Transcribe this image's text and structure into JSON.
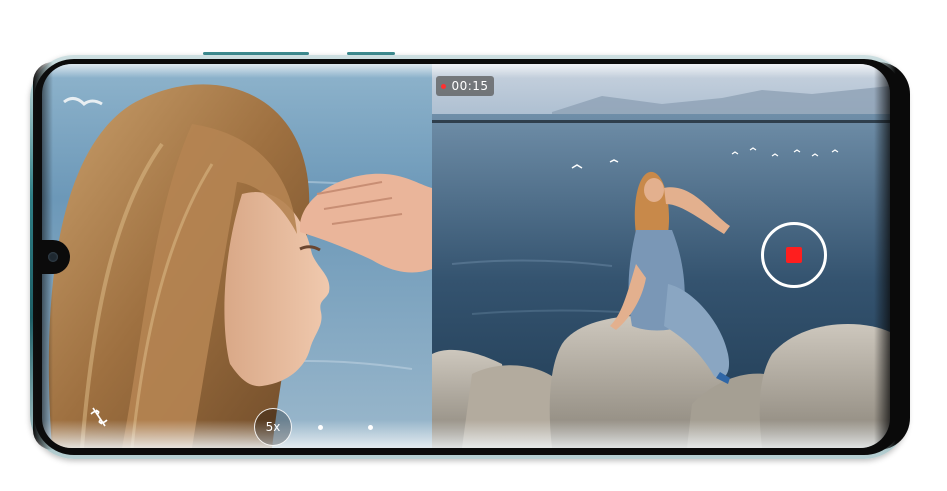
{
  "recording": {
    "timer": "00:15",
    "indicator_color": "#ff3030",
    "stop_button_color": "#ff1e1e"
  },
  "zoom": {
    "label": "5x"
  },
  "icons": {
    "switch_camera": "camera-flip-icon",
    "record": "stop-record-icon"
  },
  "device": {
    "frame_color": "#2f7f86"
  }
}
